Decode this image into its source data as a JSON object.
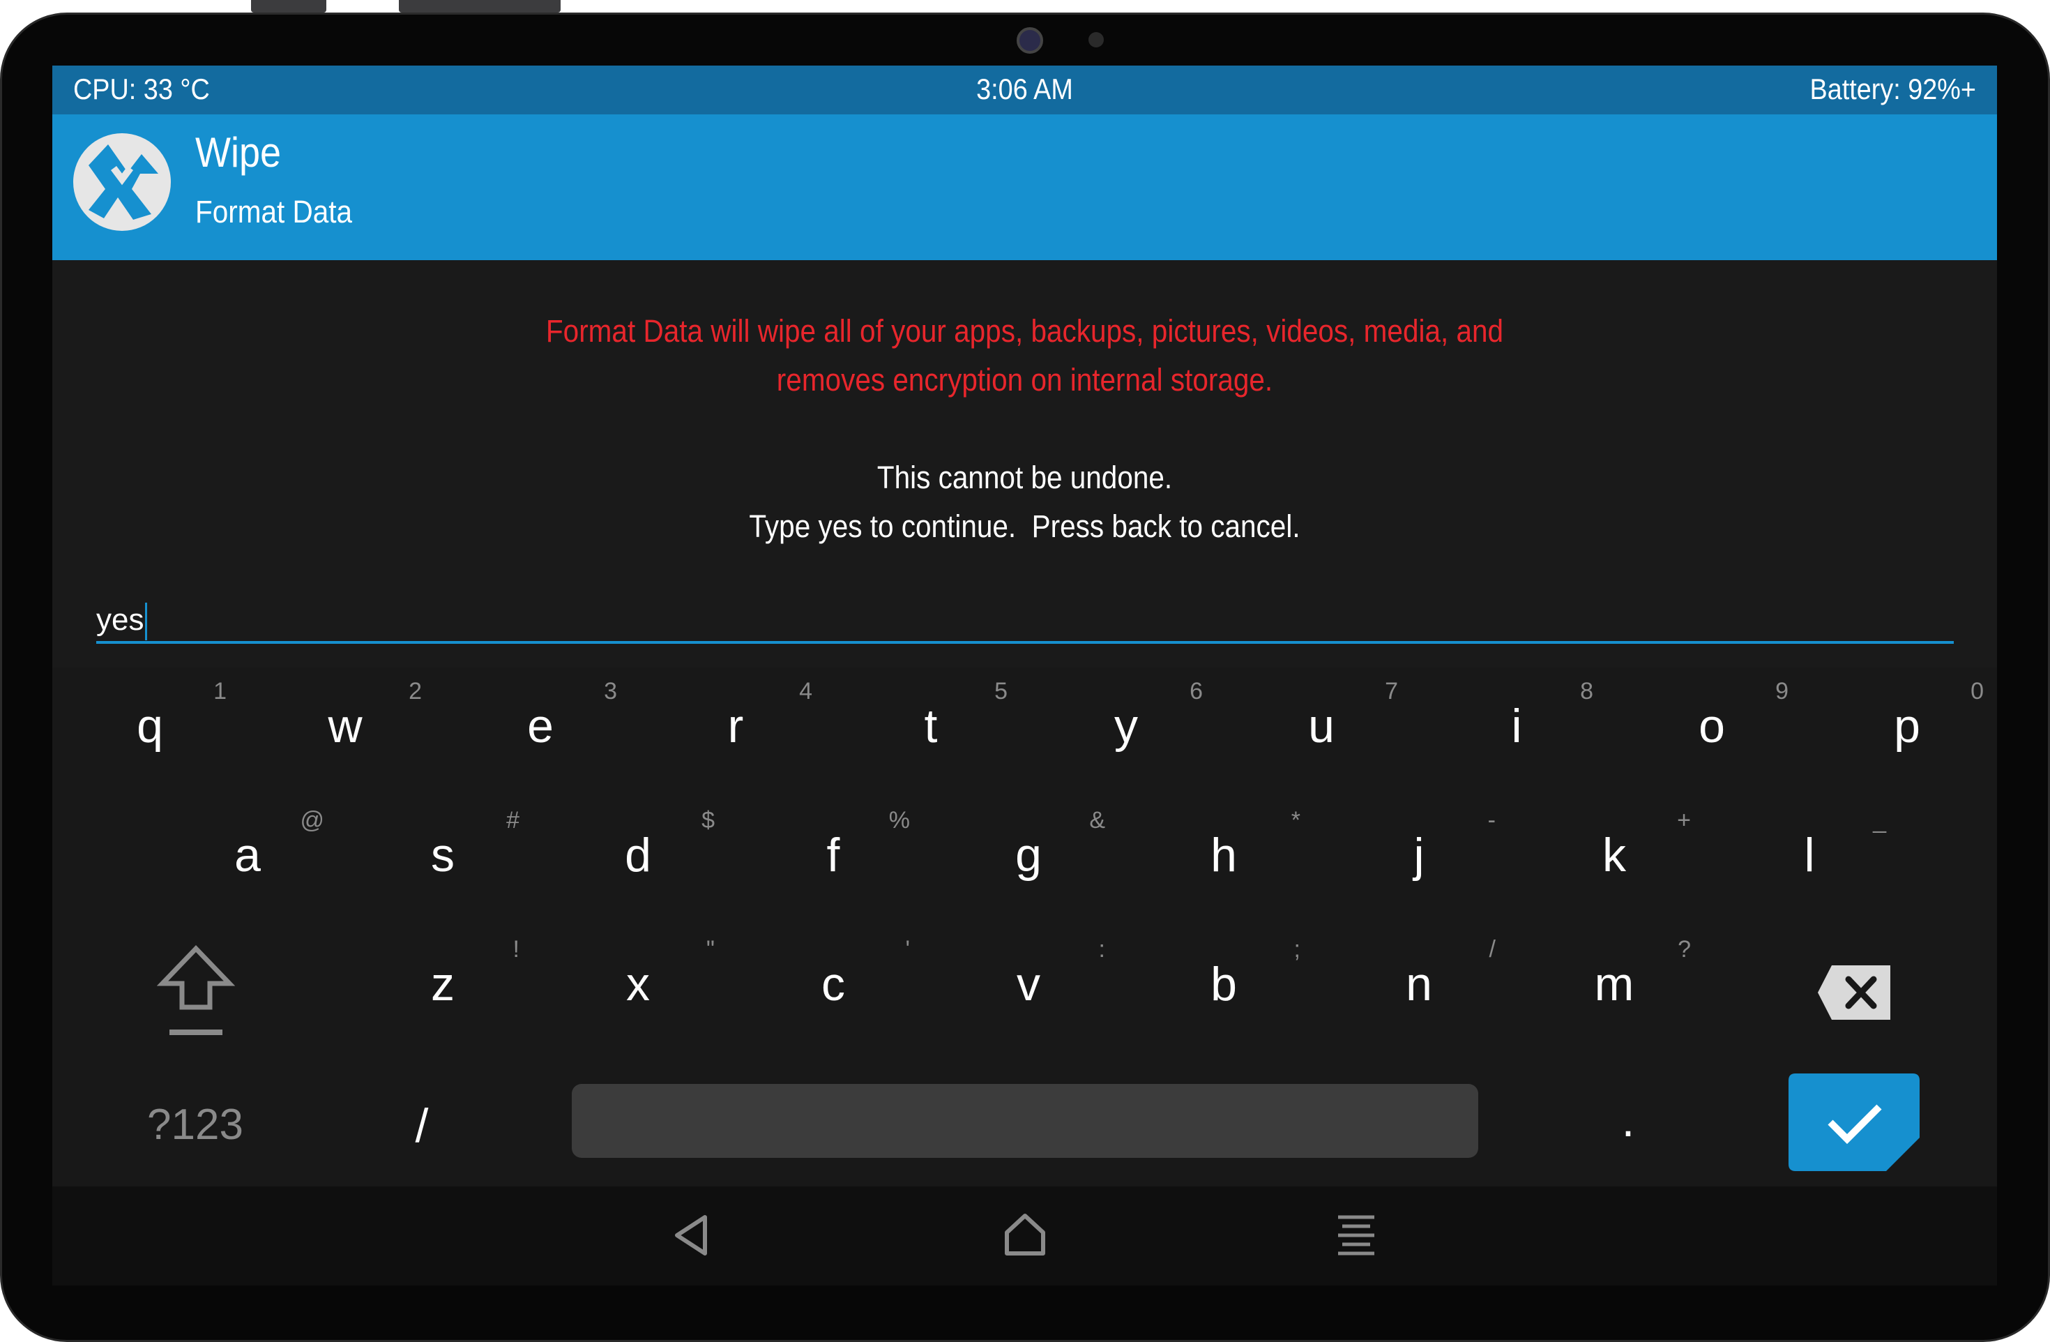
{
  "status": {
    "cpu": "CPU: 33 °C",
    "time": "3:06 AM",
    "battery": "Battery: 92%+"
  },
  "header": {
    "title": "Wipe",
    "subtitle": "Format Data"
  },
  "message": {
    "warning_line1": "Format Data will wipe all of your apps, backups, pictures, videos, media, and",
    "warning_line2": "removes encryption on internal storage.",
    "info_line1": "This cannot be undone.",
    "info_line2": "Type yes to continue.  Press back to cancel."
  },
  "input": {
    "value": "yes"
  },
  "keyboard": {
    "row1": [
      {
        "key": "q",
        "hint": "1"
      },
      {
        "key": "w",
        "hint": "2"
      },
      {
        "key": "e",
        "hint": "3"
      },
      {
        "key": "r",
        "hint": "4"
      },
      {
        "key": "t",
        "hint": "5"
      },
      {
        "key": "y",
        "hint": "6"
      },
      {
        "key": "u",
        "hint": "7"
      },
      {
        "key": "i",
        "hint": "8"
      },
      {
        "key": "o",
        "hint": "9"
      },
      {
        "key": "p",
        "hint": "0"
      }
    ],
    "row2": [
      {
        "key": "a",
        "hint": "@"
      },
      {
        "key": "s",
        "hint": "#"
      },
      {
        "key": "d",
        "hint": "$"
      },
      {
        "key": "f",
        "hint": "%"
      },
      {
        "key": "g",
        "hint": "&"
      },
      {
        "key": "h",
        "hint": "*"
      },
      {
        "key": "j",
        "hint": "-"
      },
      {
        "key": "k",
        "hint": "+"
      },
      {
        "key": "l",
        "hint": "_"
      }
    ],
    "row3": [
      {
        "key": "z",
        "hint": "!"
      },
      {
        "key": "x",
        "hint": "\""
      },
      {
        "key": "c",
        "hint": "'"
      },
      {
        "key": "v",
        "hint": ":"
      },
      {
        "key": "b",
        "hint": ";"
      },
      {
        "key": "n",
        "hint": "/"
      },
      {
        "key": "m",
        "hint": "?"
      }
    ],
    "symbols_key": "?123",
    "slash_key": "/",
    "period_key": ".",
    "shift_icon": "shift-icon",
    "backspace_icon": "backspace-icon",
    "enter_icon": "checkmark-icon"
  },
  "navbar": {
    "icons": [
      "back-icon",
      "home-icon",
      "menu-icon"
    ]
  },
  "colors": {
    "accent": "#1690cf",
    "statusbar": "#136b9f",
    "warning": "#e8262c",
    "background": "#1a1a1a"
  }
}
